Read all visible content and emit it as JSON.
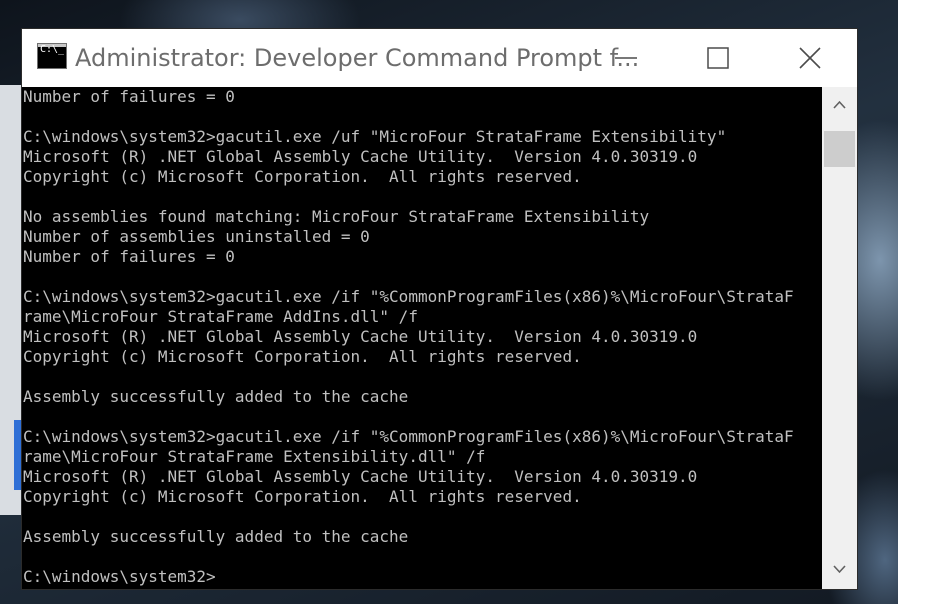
{
  "window": {
    "title": "Administrator: Developer Command Prompt f...",
    "icon_glyph": "C:\\_",
    "controls": {
      "minimize": "minimize-icon",
      "maximize": "maximize-icon",
      "close": "close-icon"
    }
  },
  "console": {
    "lines": [
      "Number of failures = 0",
      "",
      "C:\\windows\\system32>gacutil.exe /uf \"MicroFour StrataFrame Extensibility\"",
      "Microsoft (R) .NET Global Assembly Cache Utility.  Version 4.0.30319.0",
      "Copyright (c) Microsoft Corporation.  All rights reserved.",
      "",
      "No assemblies found matching: MicroFour StrataFrame Extensibility",
      "Number of assemblies uninstalled = 0",
      "Number of failures = 0",
      "",
      "C:\\windows\\system32>gacutil.exe /if \"%CommonProgramFiles(x86)%\\MicroFour\\StrataF",
      "rame\\MicroFour StrataFrame AddIns.dll\" /f",
      "Microsoft (R) .NET Global Assembly Cache Utility.  Version 4.0.30319.0",
      "Copyright (c) Microsoft Corporation.  All rights reserved.",
      "",
      "Assembly successfully added to the cache",
      "",
      "C:\\windows\\system32>gacutil.exe /if \"%CommonProgramFiles(x86)%\\MicroFour\\StrataF",
      "rame\\MicroFour StrataFrame Extensibility.dll\" /f",
      "Microsoft (R) .NET Global Assembly Cache Utility.  Version 4.0.30319.0",
      "Copyright (c) Microsoft Corporation.  All rights reserved.",
      "",
      "Assembly successfully added to the cache",
      "",
      "C:\\windows\\system32>"
    ]
  },
  "scrollbar": {
    "up_icon": "chevron-up-icon",
    "down_icon": "chevron-down-icon"
  },
  "colors": {
    "console_bg": "#000000",
    "console_text": "#c0c0c0",
    "titlebar_bg": "#ffffff",
    "title_text": "#6d6d6d"
  }
}
